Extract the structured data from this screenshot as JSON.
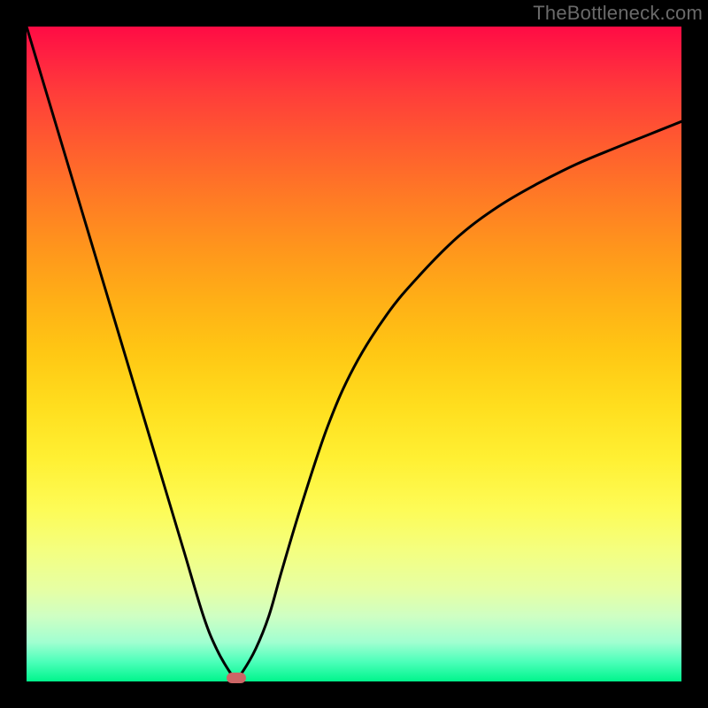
{
  "watermark": {
    "text": "TheBottleneck.com"
  },
  "colors": {
    "frame": "#000000",
    "curve": "#000000",
    "marker": "#cc6666",
    "gradient_top": "#ff0b44",
    "gradient_bottom": "#00f58c"
  },
  "chart_data": {
    "type": "line",
    "title": "",
    "xlabel": "",
    "ylabel": "",
    "xlim": [
      0,
      100
    ],
    "ylim": [
      0,
      100
    ],
    "grid": false,
    "legend": false,
    "notes": "No axis ticks or numeric labels are rendered; values are read off by position within a 0–100 normalized coordinate frame. Background is a vertical red→yellow→green gradient. A single black V-shaped curve dips to near zero around x≈32, with a small reddish marker at the minimum.",
    "series": [
      {
        "name": "curve",
        "x": [
          0,
          3,
          6,
          9,
          12,
          15,
          18,
          21,
          24,
          27,
          29,
          31,
          32,
          33,
          35,
          37,
          39,
          42,
          46,
          50,
          55,
          60,
          66,
          72,
          78,
          84,
          90,
          95,
          100
        ],
        "values": [
          100,
          90,
          80,
          70,
          60,
          50,
          40,
          30,
          20,
          10,
          5,
          1.5,
          0.5,
          1.5,
          5,
          10,
          17,
          27,
          39,
          48,
          56,
          62,
          68,
          72.5,
          76,
          79,
          81.5,
          83.5,
          85.5
        ]
      }
    ],
    "marker": {
      "x": 32,
      "y": 0.5
    }
  }
}
